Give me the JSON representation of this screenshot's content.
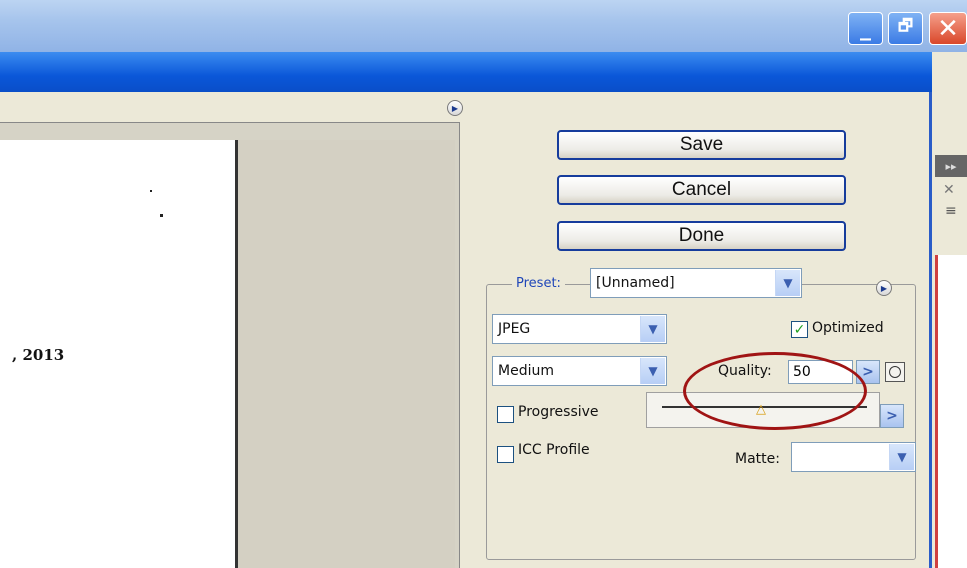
{
  "window": {
    "minimize_glyph": "_",
    "restore_glyph": "🗗",
    "close_glyph": "✕"
  },
  "preview": {
    "text": ", 2013"
  },
  "buttons": {
    "save": "Save",
    "cancel": "Cancel",
    "done": "Done"
  },
  "settings": {
    "preset_label": "Preset:",
    "preset_value": "[Unnamed]",
    "format_value": "JPEG",
    "compression_value": "Medium",
    "optimized_label": "Optimized",
    "optimized_checked": true,
    "quality_label": "Quality:",
    "quality_value": "50",
    "progressive_label": "Progressive",
    "progressive_checked": false,
    "icc_label": "ICC Profile",
    "icc_checked": false,
    "matte_label": "Matte:",
    "matte_value": ""
  },
  "icons": {
    "combo_arrow": "▼",
    "arrow_right": ">",
    "play": "▶",
    "check": "✓",
    "slider_thumb": "△",
    "panel_expand": "▸▸",
    "panel_close": "✕",
    "panel_menu": "≡"
  },
  "colors": {
    "accent_blue": "#0a57d9",
    "annotation_red": "#a01414",
    "check_green": "#21a121"
  }
}
